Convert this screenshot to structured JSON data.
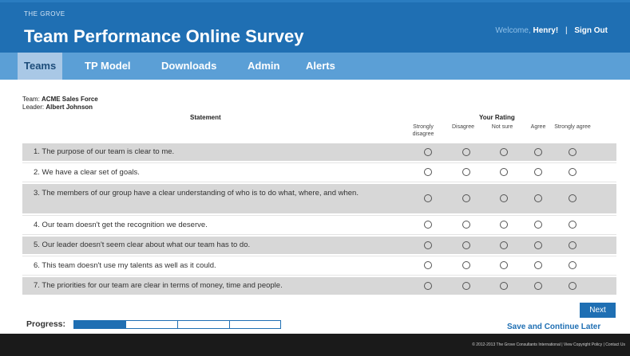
{
  "header": {
    "brand": "THE GROVE",
    "title": "Team Performance Online Survey",
    "welcome": "Welcome,",
    "username": "Henry!",
    "separator": "|",
    "signout": "Sign Out"
  },
  "nav": {
    "items": [
      {
        "label": "Teams",
        "active": true
      },
      {
        "label": "TP Model"
      },
      {
        "label": "Downloads"
      },
      {
        "label": "Admin"
      },
      {
        "label": "Alerts"
      }
    ]
  },
  "meta": {
    "team_label": "Team:",
    "team_value": "ACME Sales Force",
    "leader_label": "Leader:",
    "leader_value": "Albert Johnson"
  },
  "table": {
    "statement_header": "Statement",
    "rating_header": "Your Rating",
    "options": [
      "Strongly disagree",
      "Disagree",
      "Not sure",
      "Agree",
      "Strongly agree"
    ],
    "rows": [
      "1. The purpose of our team is clear to me.",
      "2. We have a clear set of goals.",
      "3. The members of our group have a clear understanding of who is to do what, where, and when.",
      "4. Our team doesn't get the recognition we deserve.",
      "5. Our leader doesn't seem clear about what our team has to do.",
      "6. This team doesn't use my talents as well as it could.",
      "7. The priorities for our team are clear in terms of money, time and people."
    ]
  },
  "actions": {
    "next": "Next",
    "save": "Save and Continue Later"
  },
  "progress": {
    "label": "Progress:",
    "fraction": 0.25,
    "segments": 4
  },
  "footer": {
    "text": "© 2012-2013 The Grove Consultants International | View Copyright Policy | Contact Us"
  },
  "colors": {
    "header_bg": "#1f6fb3",
    "nav_bg": "#5b9fd6",
    "row_shade": "#d7d7d7",
    "footer_bg": "#1a1a1a"
  }
}
